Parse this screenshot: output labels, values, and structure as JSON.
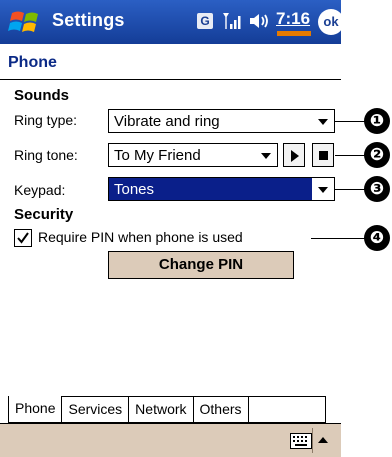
{
  "titlebar": {
    "title": "Settings",
    "g_badge": "G",
    "time": "7:16",
    "ok_label": "ok"
  },
  "page": {
    "title": "Phone"
  },
  "sounds": {
    "heading": "Sounds",
    "ring_type_label": "Ring type:",
    "ring_type_value": "Vibrate and ring",
    "ring_tone_label": "Ring tone:",
    "ring_tone_value": "To My Friend",
    "keypad_label": "Keypad:",
    "keypad_value": "Tones"
  },
  "security": {
    "heading": "Security",
    "require_pin_label": "Require PIN when phone is used",
    "require_pin_checked": true,
    "change_pin_label": "Change PIN"
  },
  "callouts": [
    "❶",
    "❷",
    "❸",
    "❹"
  ],
  "tabs": [
    {
      "label": "Phone",
      "active": true
    },
    {
      "label": "Services"
    },
    {
      "label": "Network"
    },
    {
      "label": "Others"
    }
  ],
  "icons": {
    "start": "windows-flag-icon",
    "signal": "signal-strength-icon",
    "volume": "speaker-icon",
    "keyboard": "keyboard-icon",
    "play": "play-icon",
    "stop": "stop-icon"
  },
  "colors": {
    "titlebar": "#1f4fb2",
    "heading_blue": "#0b2a86",
    "selection": "#0a1f8a",
    "menubar": "#dccbb9",
    "battery": "#e67a00"
  }
}
